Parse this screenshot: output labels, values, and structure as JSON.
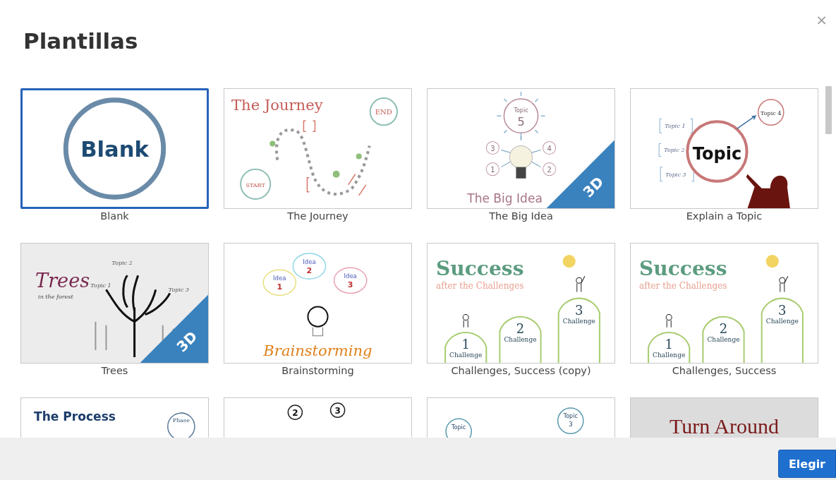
{
  "dialog": {
    "title": "Plantillas",
    "close": "×",
    "button": "Elegir"
  },
  "templates": [
    {
      "name": "Blank",
      "selected": true,
      "preview": {
        "kind": "blank",
        "texts": [
          "Blank"
        ]
      }
    },
    {
      "name": "The Journey",
      "selected": false,
      "preview": {
        "kind": "journey",
        "texts": [
          "The Journey",
          "END",
          "START"
        ]
      }
    },
    {
      "name": "The Big Idea",
      "selected": false,
      "preview": {
        "kind": "bigidea",
        "texts": [
          "Topic",
          "5",
          "3",
          "4",
          "1",
          "2",
          "The Big Idea"
        ],
        "badge": "3D"
      }
    },
    {
      "name": "Explain a Topic",
      "selected": false,
      "preview": {
        "kind": "topic",
        "texts": [
          "Topic 1",
          "Topic 2",
          "Topic 3",
          "Topic",
          "Topic 4"
        ]
      }
    },
    {
      "name": "Trees",
      "selected": false,
      "preview": {
        "kind": "trees",
        "texts": [
          "Trees",
          "in the forest",
          "Topic 2",
          "Topic 1",
          "Topic 3"
        ],
        "badge": "3D"
      }
    },
    {
      "name": "Brainstorming",
      "selected": false,
      "preview": {
        "kind": "brainstorm",
        "texts": [
          "Idea",
          "1",
          "Idea",
          "2",
          "Idea",
          "3",
          "Brainstorming"
        ]
      }
    },
    {
      "name": "Challenges, Success (copy)",
      "selected": false,
      "preview": {
        "kind": "success",
        "texts": [
          "Success",
          "after the Challenges",
          "1",
          "Challenge",
          "2",
          "Challenge",
          "3",
          "Challenge"
        ]
      }
    },
    {
      "name": "Challenges, Success",
      "selected": false,
      "preview": {
        "kind": "success",
        "texts": [
          "Success",
          "after the Challenges",
          "1",
          "Challenge",
          "2",
          "Challenge",
          "3",
          "Challenge"
        ]
      }
    },
    {
      "selected": false,
      "preview": {
        "kind": "process",
        "texts": [
          "The Process",
          "Phase"
        ]
      }
    },
    {
      "selected": false,
      "preview": {
        "kind": "numbers",
        "texts": [
          "2",
          "3"
        ]
      }
    },
    {
      "selected": false,
      "preview": {
        "kind": "topics",
        "texts": [
          "Topic",
          "Topic",
          "3"
        ]
      }
    },
    {
      "selected": false,
      "preview": {
        "kind": "turnaround",
        "texts": [
          "Turn Around"
        ]
      }
    }
  ]
}
